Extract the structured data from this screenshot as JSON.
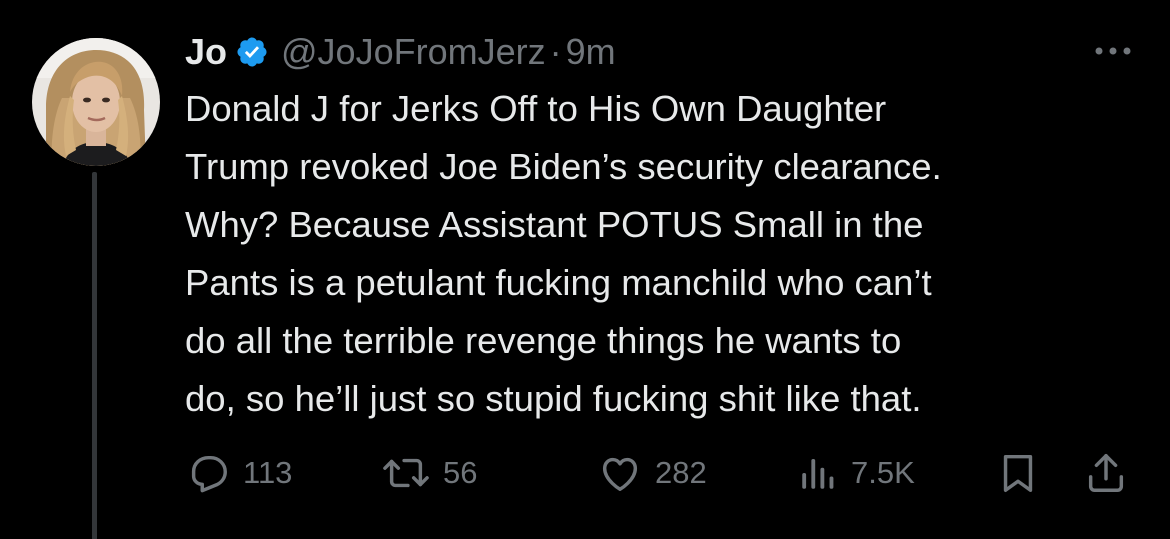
{
  "tweet": {
    "author_name": "Jo",
    "handle": "@JoJoFromJerz",
    "separator": "·",
    "time": "9m",
    "body_lines": [
      "Donald J for Jerks Off to His Own Daughter",
      "Trump revoked Joe Biden’s security clearance.",
      "Why? Because Assistant POTUS Small in the",
      "Pants is a petulant fucking manchild who can’t",
      "do all the terrible revenge things he wants to",
      "do, so he’ll just so stupid fucking shit like that."
    ],
    "actions": {
      "replies": "113",
      "reposts": "56",
      "likes": "282",
      "views": "7.5K"
    }
  },
  "icons": {
    "verified": "verified-badge-icon",
    "more": "more-icon",
    "reply": "reply-icon",
    "repost": "repost-icon",
    "like": "like-icon",
    "views": "views-icon",
    "bookmark": "bookmark-icon",
    "share": "share-icon"
  },
  "colors": {
    "background": "#000000",
    "text": "#e7e9ea",
    "secondary": "#71767b",
    "verified": "#1d9bf0",
    "thread_line": "#333639"
  }
}
